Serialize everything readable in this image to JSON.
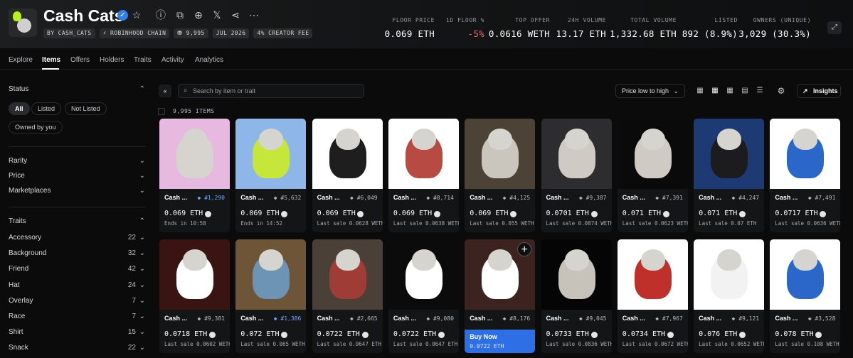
{
  "collection": {
    "title": "Cash Cats",
    "tags": [
      "BY CASH_CATS",
      "⚡ ROBINHOOD CHAIN",
      "⛃ 9,995",
      "JUL 2026",
      "4% CREATOR FEE"
    ]
  },
  "stats": [
    {
      "label": "FLOOR PRICE",
      "value": "0.069 ETH"
    },
    {
      "label": "1D FLOOR %",
      "value": "-5%"
    },
    {
      "label": "TOP OFFER",
      "value": "0.0616 WETH"
    },
    {
      "label": "24H VOLUME",
      "value": "13.17 ETH"
    },
    {
      "label": "TOTAL VOLUME",
      "value": "1,332.68 ETH"
    },
    {
      "label": "LISTED",
      "value": "892 (8.9%)"
    },
    {
      "label": "OWNERS (UNIQUE)",
      "value": "3,029 (30.3%)"
    }
  ],
  "tabs": [
    "Explore",
    "Items",
    "Offers",
    "Holders",
    "Traits",
    "Activity",
    "Analytics"
  ],
  "sidebar": {
    "status_label": "Status",
    "status_chips": [
      "All",
      "Listed",
      "Not Listed",
      "Owned by you"
    ],
    "filters": [
      "Rarity",
      "Price",
      "Marketplaces"
    ],
    "traits_label": "Traits",
    "traits": [
      {
        "name": "Accessory",
        "count": "22"
      },
      {
        "name": "Background",
        "count": "32"
      },
      {
        "name": "Friend",
        "count": "42"
      },
      {
        "name": "Hat",
        "count": "24"
      },
      {
        "name": "Overlay",
        "count": "7"
      },
      {
        "name": "Race",
        "count": "7"
      },
      {
        "name": "Shirt",
        "count": "15"
      },
      {
        "name": "Snack",
        "count": "22"
      }
    ]
  },
  "toolbar": {
    "search_placeholder": "Search by item or trait",
    "sort_label": "Price low to high",
    "insights_label": "Insights"
  },
  "items_count": "9,995 ITEMS",
  "currency": "ETH",
  "buy_now_label": "Buy Now",
  "cards": [
    {
      "name": "Cash ...",
      "rank": "#1,290",
      "blue": true,
      "price": "0.069",
      "sub": "Ends in 10:58"
    },
    {
      "name": "Cash ...",
      "rank": "#5,632",
      "blue": false,
      "price": "0.069",
      "sub": "Ends in 14:52"
    },
    {
      "name": "Cash ...",
      "rank": "#6,049",
      "blue": false,
      "price": "0.069",
      "sub": "Last sale 0.0628 WETH"
    },
    {
      "name": "Cash ...",
      "rank": "#8,714",
      "blue": false,
      "price": "0.069",
      "sub": "Last sale 0.0638 WETH"
    },
    {
      "name": "Cash ...",
      "rank": "#4,125",
      "blue": false,
      "price": "0.069",
      "sub": "Last sale 0.055 WETH"
    },
    {
      "name": "Cash ...",
      "rank": "#9,387",
      "blue": false,
      "price": "0.0701",
      "sub": "Last sale 0.0874 WETH"
    },
    {
      "name": "Cash ...",
      "rank": "#7,391",
      "blue": false,
      "price": "0.071",
      "sub": "Last sale 0.0623 WETH"
    },
    {
      "name": "Cash ...",
      "rank": "#4,247",
      "blue": false,
      "price": "0.071",
      "sub": "Last sale 0.07 ETH"
    },
    {
      "name": "Cash ...",
      "rank": "#7,491",
      "blue": false,
      "price": "0.0717",
      "sub": "Last sale 0.0636 WETH"
    },
    {
      "name": "Cash ...",
      "rank": "#9,381",
      "blue": false,
      "price": "0.0718",
      "sub": "Last sale 0.0602 WETH"
    },
    {
      "name": "Cash ...",
      "rank": "#1,386",
      "blue": true,
      "price": "0.072",
      "sub": "Last sale 0.065 WETH"
    },
    {
      "name": "Cash ...",
      "rank": "#2,665",
      "blue": false,
      "price": "0.0722",
      "sub": "Last sale 0.0647 ETH"
    },
    {
      "name": "Cash ...",
      "rank": "#9,080",
      "blue": false,
      "price": "0.0722",
      "sub": "Last sale 0.0647 ETH"
    },
    {
      "name": "Cash ...",
      "rank": "#8,176",
      "blue": false,
      "price": "0.0722 ETH",
      "sub": "",
      "buy_now": true
    },
    {
      "name": "Cash ...",
      "rank": "#9,045",
      "blue": false,
      "price": "0.0733",
      "sub": "Last sale 0.0836 WETH"
    },
    {
      "name": "Cash ...",
      "rank": "#7,967",
      "blue": false,
      "price": "0.0734",
      "sub": "Last sale 0.0672 WETH"
    },
    {
      "name": "Cash ...",
      "rank": "#9,121",
      "blue": false,
      "price": "0.076",
      "sub": "Last sale 0.0652 WETH"
    },
    {
      "name": "Cash ...",
      "rank": "#3,528",
      "blue": false,
      "price": "0.078",
      "sub": "Last sale 0.108 WETH"
    }
  ],
  "card_art": [
    {
      "bg": "#e7b8e0",
      "body": "#d7d4cf"
    },
    {
      "bg": "#8fb6e8",
      "body": "#c7e63a"
    },
    {
      "bg": "#ffffff",
      "body": "#1e1e1e"
    },
    {
      "bg": "#ffffff",
      "body": "#b84a44"
    },
    {
      "bg": "#4c4235",
      "body": "#cbc6bd"
    },
    {
      "bg": "#2d2d2f",
      "body": "#cfcbc4"
    },
    {
      "bg": "#0a0a0a",
      "body": "#cfcbc4"
    },
    {
      "bg": "#1d3a74",
      "body": "#1c1c1e"
    },
    {
      "bg": "#ffffff",
      "body": "#2a67c9"
    },
    {
      "bg": "#3a1412",
      "body": "#ffffff"
    },
    {
      "bg": "#6e5537",
      "body": "#6d93b5"
    },
    {
      "bg": "#4a4038",
      "body": "#a03c36"
    },
    {
      "bg": "#0b0b0b",
      "body": "#ffffff"
    },
    {
      "bg": "#3d2320",
      "body": "#ffffff"
    },
    {
      "bg": "#050505",
      "body": "#c7c3bb"
    },
    {
      "bg": "#ffffff",
      "body": "#c0302a"
    },
    {
      "bg": "#ffffff",
      "body": "#f2f2f2"
    },
    {
      "bg": "#ffffff",
      "body": "#2a67c9"
    }
  ]
}
